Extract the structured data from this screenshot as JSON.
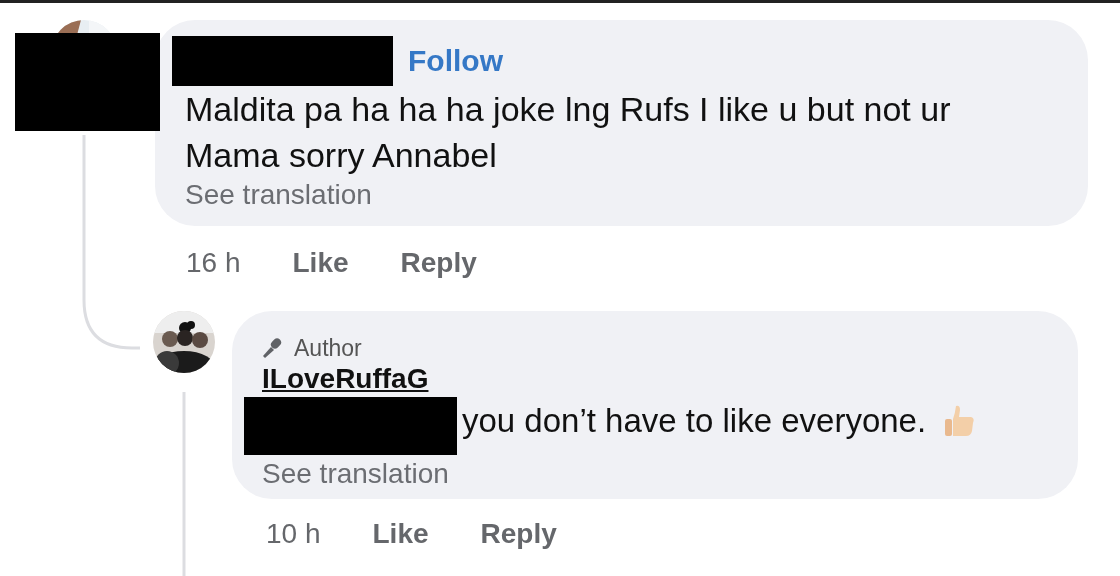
{
  "comment": {
    "avatar_redacted": true,
    "name_redacted": true,
    "follow": "Follow",
    "text": "Maldita pa ha ha ha joke lng Rufs I like u but not ur Mama sorry Annabel",
    "see_translation": "See translation",
    "time": "16 h",
    "actions": [
      "Like",
      "Reply"
    ]
  },
  "reply": {
    "badge": "Author",
    "name": "ILoveRuffaG",
    "mention_redacted": true,
    "text": "you don’t have to like everyone.",
    "see_translation": "See translation",
    "time": "10 h",
    "actions": [
      "Like",
      "Reply"
    ]
  }
}
